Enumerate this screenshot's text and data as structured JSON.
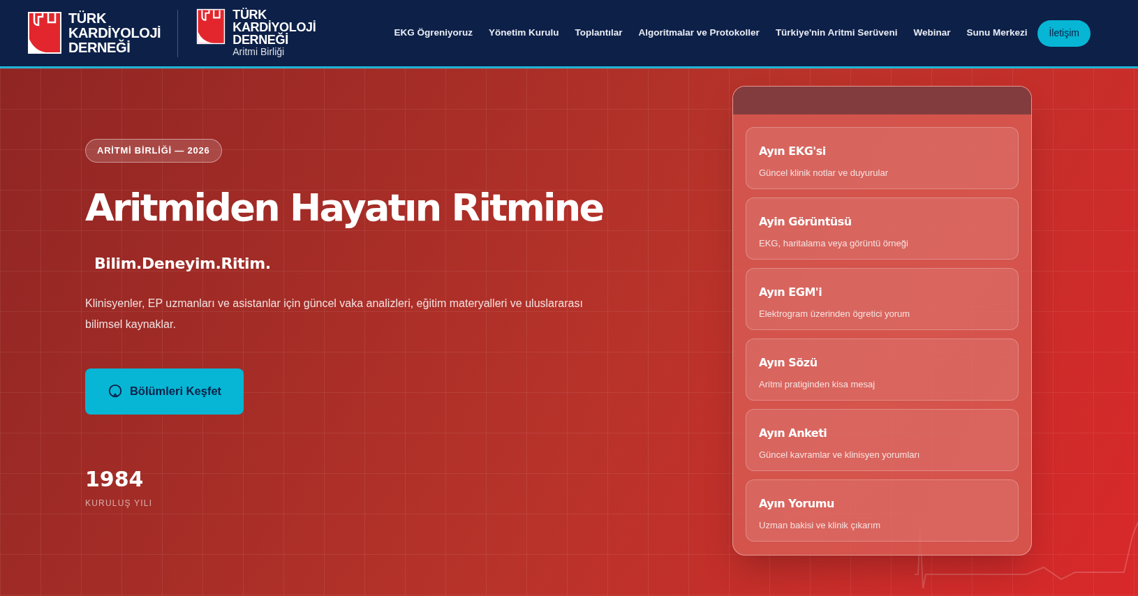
{
  "header": {
    "logos": [
      {
        "lines": [
          "TÜRK",
          "KARDİYOLOJİ",
          "DERNEĞİ"
        ]
      },
      {
        "lines": [
          "TÜRK",
          "KARDİYOLOJİ",
          "DERNEĞİ"
        ],
        "subtitle": "Aritmi Birliği"
      }
    ],
    "nav": [
      {
        "label": "EKG Ögreniyoruz",
        "kind": "link"
      },
      {
        "label": "Yönetim Kurulu",
        "kind": "link"
      },
      {
        "label": "Toplantılar",
        "kind": "link"
      },
      {
        "label": "Algoritmalar ve Protokoller",
        "kind": "link"
      },
      {
        "label": "Türkiye'nin Aritmi Serüveni",
        "kind": "link"
      },
      {
        "label": "Webinar",
        "kind": "link"
      },
      {
        "label": "Sunu Merkezi",
        "kind": "link"
      },
      {
        "label": "İletişim",
        "kind": "button"
      }
    ]
  },
  "hero": {
    "badge": "ARİTMİ BİRLİĞİ — 2026",
    "title": "Aritmiden Hayatın Ritmine",
    "tagline": "Bilim.Deneyim.Ritim.",
    "description": "Klinisyenler, EP uzmanları ve asistanlar için güncel vaka analizleri, eğitim materyalleri ve uluslararası bilimsel kaynaklar.",
    "button": "Bölümleri Keşfet",
    "stat": {
      "value": "1984",
      "label": "KURULUŞ YILI"
    }
  },
  "panel": {
    "items": [
      {
        "title": "Ayın EKG'si",
        "subtitle": "Güncel klinik notlar ve duyurular"
      },
      {
        "title": "Ayin Görüntüsü",
        "subtitle": "EKG, haritalama veya görüntü örneği"
      },
      {
        "title": "Ayın EGM'i",
        "subtitle": "Elektrogram üzerinden ögretici yorum"
      },
      {
        "title": "Ayın Sözü",
        "subtitle": "Aritmi pratiginden kisa mesaj"
      },
      {
        "title": "Ayın Anketi",
        "subtitle": "Güncel kavramlar ve klinisyen yorumları"
      },
      {
        "title": "Ayın Yorumu",
        "subtitle": "Uzman bakisi ve klinik çıkarım"
      }
    ]
  }
}
